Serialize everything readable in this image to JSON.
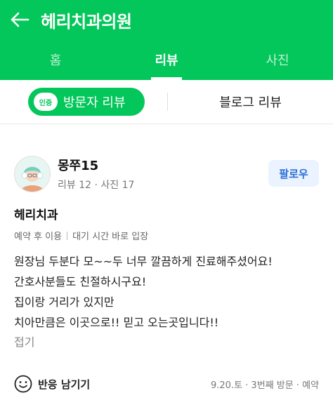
{
  "header": {
    "title": "헤리치과의원"
  },
  "tabs": [
    {
      "label": "홈"
    },
    {
      "label": "리뷰",
      "active": true
    },
    {
      "label": "사진"
    }
  ],
  "subtabs": {
    "badge": "인증",
    "visitor_label": "방문자 리뷰",
    "blog_label": "블로그 리뷰"
  },
  "review": {
    "username": "몽쭈15",
    "stats": "리뷰 12 · 사진 17",
    "follow_label": "팔로우",
    "place": "헤리치과",
    "tags": [
      "예약 후 이용",
      "대기 시간 바로 입장"
    ],
    "lines": [
      "원장님 두분다 모~~두 너무 깔끔하게 진료해주셨어요!",
      "간호사분들도 친절하시구요!",
      "집이랑 거리가 있지만",
      "치아만큼은 이곳으로!! 믿고 오는곳입니다!!"
    ],
    "fold_label": "접기",
    "react_label": "반응 남기기",
    "meta": "9.20.토 · 3번째 방문 · 예약"
  },
  "colors": {
    "brand": "#03c75a",
    "follow_bg": "#eaf3ff",
    "follow_text": "#2d6fd6"
  }
}
